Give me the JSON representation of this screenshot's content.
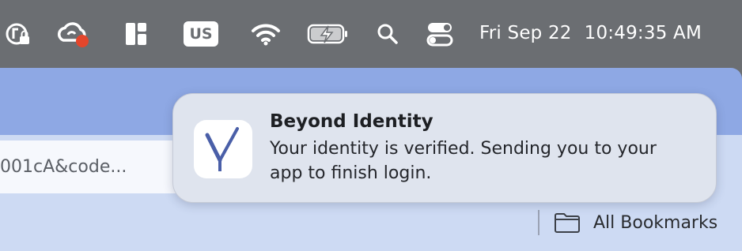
{
  "menubar": {
    "icons": [
      "lock-status-icon",
      "creative-cloud-icon",
      "window-layout-icon",
      "keyboard-input-icon",
      "wifi-icon",
      "battery-charging-icon",
      "spotlight-search-icon",
      "control-center-icon"
    ],
    "input_source_label": "US",
    "date": "Fri Sep 22",
    "time": "10:49:35 AM",
    "background_color": "#6b6e72"
  },
  "browser": {
    "url_fragment": "001cA&code...",
    "bookmarks_label": "All Bookmarks",
    "toolbar_color": "#8ea8e4",
    "bar_color": "#cddaf3"
  },
  "notification": {
    "app_icon": "beyond-identity-icon",
    "title": "Beyond Identity",
    "body": "Your identity is verified. Sending you to your app to finish login.",
    "brand_color": "#4a5fa8"
  }
}
